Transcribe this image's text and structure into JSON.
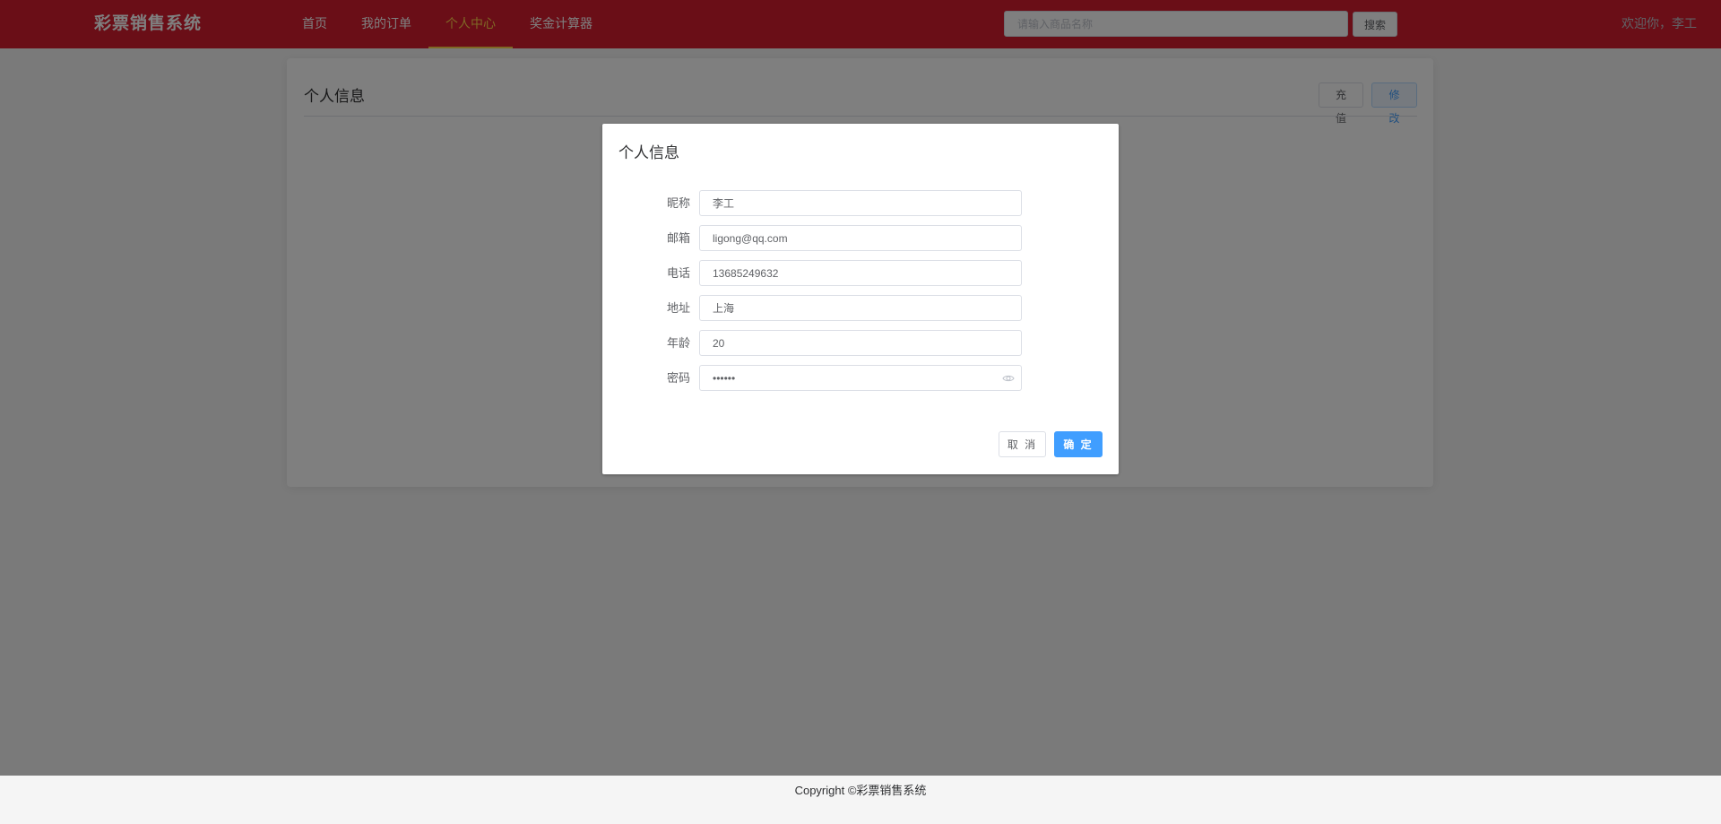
{
  "header": {
    "brand": "彩票销售系统",
    "nav": [
      {
        "label": "首页",
        "active": false
      },
      {
        "label": "我的订单",
        "active": false
      },
      {
        "label": "个人中心",
        "active": true
      },
      {
        "label": "奖金计算器",
        "active": false
      }
    ],
    "search": {
      "placeholder": "请输入商品名称",
      "value": "",
      "button_label": "搜索"
    },
    "user_name": "欢迎你，李工"
  },
  "profile_card": {
    "title": "个人信息",
    "recharge_label": "充值",
    "edit_label": "修改"
  },
  "dialog": {
    "title": "个人信息",
    "fields": [
      {
        "label": "昵称",
        "value": "李工"
      },
      {
        "label": "邮箱",
        "value": "ligong@qq.com"
      },
      {
        "label": "电话",
        "value": "13685249632"
      },
      {
        "label": "地址",
        "value": "上海"
      },
      {
        "label": "年龄",
        "value": "20"
      },
      {
        "label": "密码",
        "value": "••••••"
      }
    ],
    "password_toggle_icon": "eye-icon",
    "cancel_label": "取 消",
    "confirm_label": "确 定"
  },
  "footer": {
    "copyright": "Copyright ©彩票销售系统"
  },
  "colors": {
    "header_bg": "#d41d2e",
    "active_nav": "#ffd04b",
    "primary": "#409eff"
  }
}
